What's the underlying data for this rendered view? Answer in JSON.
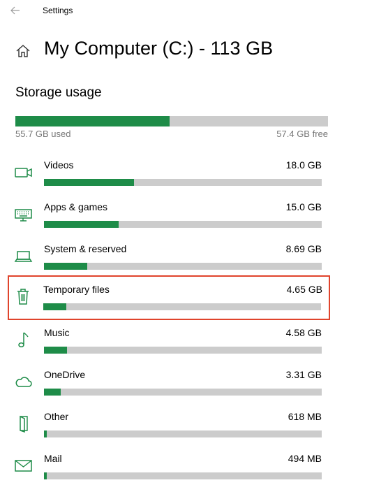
{
  "window": {
    "app_title": "Settings"
  },
  "header": {
    "title": "My Computer (C:) - 113 GB"
  },
  "storage": {
    "section_title": "Storage usage",
    "used_label": "55.7 GB used",
    "free_label": "57.4 GB free",
    "used_fraction": 0.493,
    "categories": [
      {
        "name": "Videos",
        "size": "18.0 GB",
        "fraction": 0.325,
        "icon": "video-camera-icon"
      },
      {
        "name": "Apps & games",
        "size": "15.0 GB",
        "fraction": 0.27,
        "icon": "keyboard-icon"
      },
      {
        "name": "System & reserved",
        "size": "8.69 GB",
        "fraction": 0.156,
        "icon": "laptop-icon"
      },
      {
        "name": "Temporary files",
        "size": "4.65 GB",
        "fraction": 0.083,
        "icon": "trash-icon"
      },
      {
        "name": "Music",
        "size": "4.58 GB",
        "fraction": 0.083,
        "icon": "music-note-icon"
      },
      {
        "name": "OneDrive",
        "size": "3.31 GB",
        "fraction": 0.06,
        "icon": "cloud-icon"
      },
      {
        "name": "Other",
        "size": "618 MB",
        "fraction": 0.011,
        "icon": "folder-door-icon"
      },
      {
        "name": "Mail",
        "size": "494 MB",
        "fraction": 0.009,
        "icon": "mail-icon"
      }
    ]
  },
  "colors": {
    "accent_green": "#1e8c48",
    "bar_track": "#cccccc",
    "highlight_border": "#e0442c",
    "muted_text": "#767676"
  }
}
